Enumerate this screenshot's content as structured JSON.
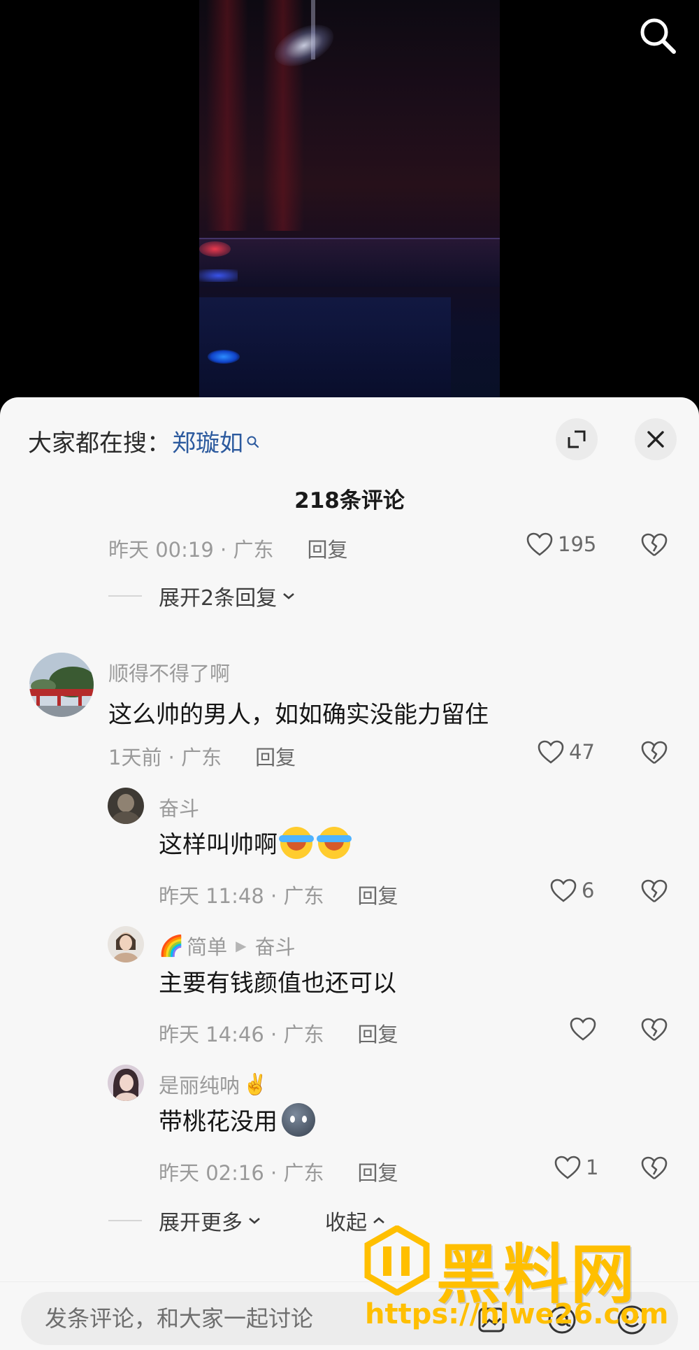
{
  "hot_search": {
    "label": "大家都在搜：",
    "term": "郑璇如"
  },
  "comments_header": {
    "count_label": "218条评论"
  },
  "top_partial": {
    "time_location": "昨天 00:19 · 广东",
    "reply": "回复",
    "likes": "195",
    "expand_replies": "展开2条回复"
  },
  "comment_main": {
    "username": "顺得不得了啊",
    "text": "这么帅的男人，如如确实没能力留住",
    "time_location": "1天前 · 广东",
    "reply": "回复",
    "likes": "47"
  },
  "replies": [
    {
      "username": "奋斗",
      "text": "这样叫帅啊",
      "emojis": [
        "loudly-crying-emoji",
        "loudly-crying-emoji"
      ],
      "time_location": "昨天 11:48 · 广东",
      "reply": "回复",
      "likes": "6"
    },
    {
      "username_prefix_emoji": "🌈",
      "username": "简单",
      "reply_to_arrow": "▶",
      "reply_to": "奋斗",
      "text": "主要有钱颜值也还可以",
      "time_location": "昨天 14:46 · 广东",
      "reply": "回复",
      "likes": ""
    },
    {
      "username": "是丽纯呐",
      "username_suffix_emoji": "✌️",
      "text": "带桃花没用",
      "emojis": [
        "dark-ball-emoji"
      ],
      "time_location": "昨天 02:16 · 广东",
      "reply": "回复",
      "likes": "1"
    }
  ],
  "thread_footer": {
    "expand_more": "展开更多",
    "collapse": "收起"
  },
  "input_bar": {
    "placeholder": "发条评论，和大家一起讨论"
  },
  "watermark": {
    "title": "黑料网",
    "url": "https://hlwe26.com"
  },
  "colors": {
    "sheet_background": "#f7f7f7",
    "link_blue": "#2c5a9e",
    "watermark_gold": "#ffbf00"
  }
}
